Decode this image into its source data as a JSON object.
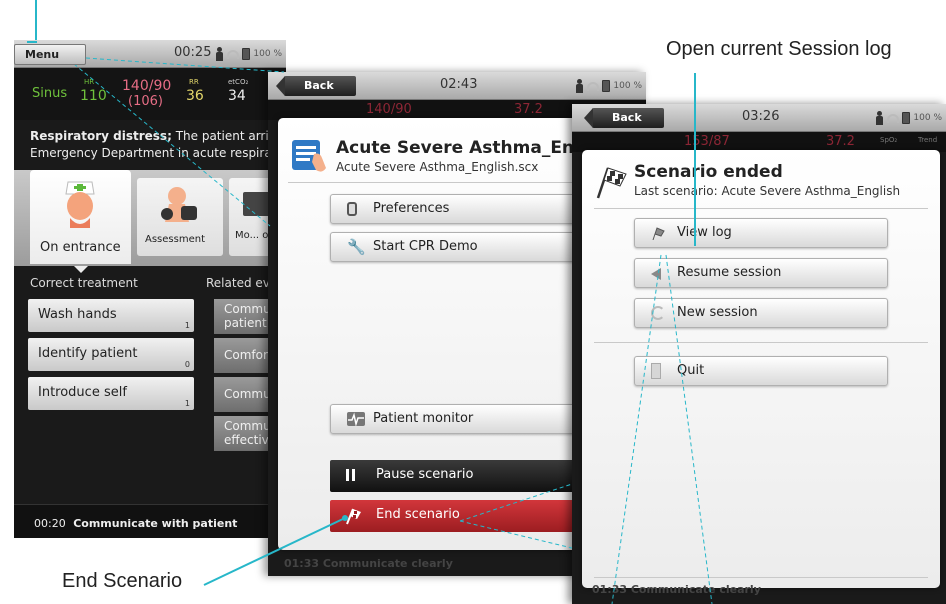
{
  "annotations": {
    "open_log": "Open current Session log",
    "end_scenario": "End Scenario"
  },
  "colors": {
    "callout_line": "#27b7c9",
    "end_button": "#b32327",
    "hr": "#6fc23c",
    "bp": "#e66d85"
  },
  "screen1": {
    "menu_label": "Menu",
    "clock": "00:25",
    "battery": "100 %",
    "rhythm": "Sinus",
    "hr_label": "HR",
    "hr_value": "110",
    "bp_value": "140/90",
    "bp_mean": "(106)",
    "rr_label": "RR",
    "rr_value": "36",
    "etco2_label": "etCO₂",
    "etco2_value": "34",
    "desc_bold": "Respiratory distress;",
    "desc_text": " The patient arrives in the",
    "desc_line2": "Emergency Department in acute respiratory",
    "tabs": [
      {
        "label": "On entrance",
        "icon": "nurse-icon"
      },
      {
        "label": "Assessment",
        "icon": "bp-cuff-icon"
      },
      {
        "label": "Mo... o",
        "icon": "monitor-icon"
      }
    ],
    "left_header": "Correct treatment",
    "right_header": "Related ev",
    "treatments": [
      {
        "label": "Wash hands",
        "count": "1"
      },
      {
        "label": "Identify patient",
        "count": "0"
      },
      {
        "label": "Introduce self",
        "count": "1"
      }
    ],
    "related": [
      "Commun patient",
      "Comfort",
      "Commun",
      "Commun effective"
    ],
    "footer_time": "00:20",
    "footer_text": "Communicate with patient"
  },
  "screen2": {
    "back": "Back",
    "clock": "02:43",
    "battery": "100 %",
    "bp_value": "140/90",
    "etco2_value": "37.2",
    "title": "Acute Severe Asthma_En",
    "subtitle": "Acute Severe Asthma_English.scx",
    "buttons": {
      "preferences": "Preferences",
      "cpr_demo": "Start CPR Demo",
      "patient_monitor": "Patient monitor",
      "pause": "Pause scenario",
      "end": "End scenario"
    },
    "footer": "01:33 Communicate clearly"
  },
  "screen3": {
    "back": "Back",
    "clock": "03:26",
    "battery": "100 %",
    "bp_value": "153/87",
    "etco2_value": "37.2",
    "spo2_label": "SpO₂",
    "trend_label": "Trend",
    "title": "Scenario ended",
    "subtitle": "Last scenario: Acute Severe Asthma_English",
    "buttons": {
      "view_log": "View log",
      "resume": "Resume session",
      "new_session": "New session",
      "quit": "Quit"
    },
    "footer": "01:33 Communicate clearly"
  }
}
